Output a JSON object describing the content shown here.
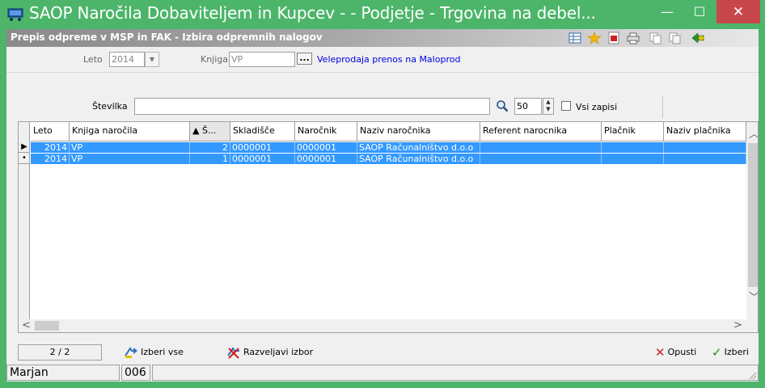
{
  "window": {
    "title": "SAOP Naročila Dobaviteljem in Kupcev -  - Podjetje - Trgovina na debel...",
    "minimize_glyph": "—",
    "maximize_glyph": "☐",
    "close_glyph": "✕"
  },
  "subtitle": "Prepis odpreme v MSP in FAK - Izbira odpremnih nalogov",
  "toolbar_icons": [
    "grid-view-icon",
    "star-icon",
    "pdf-icon",
    "print-icon",
    "copy-icon",
    "copy-alt-icon",
    "exit-icon"
  ],
  "filters": {
    "leto_label": "Leto",
    "leto_value": "2014",
    "knjiga_label": "Knjiga",
    "knjiga_value": "VP",
    "knjiga_button": "...",
    "knjiga_description": "Veleprodaja prenos na Maloprod",
    "stevilka_label": "Številka",
    "stevilka_value": "",
    "count_value": "50",
    "vsi_zapisi_label": "Vsi zapisi"
  },
  "table": {
    "columns": [
      "Leto",
      "Knjiga naročila",
      "▲ Š...",
      "Skladišče",
      "Naročnik",
      "Naziv naročnika",
      "Referent narocnika",
      "Plačnik",
      "Naziv plačnika"
    ],
    "rows": [
      {
        "indicator": "▶",
        "cells": [
          "2014",
          "VP",
          "2",
          "0000001",
          "0000001",
          "SAOP Računalništvo d.o.o",
          "",
          "",
          ""
        ]
      },
      {
        "indicator": "•",
        "cells": [
          "2014",
          "VP",
          "1",
          "0000001",
          "0000001",
          "SAOP Računalništvo d.o.o",
          "",
          "",
          ""
        ]
      }
    ]
  },
  "bottom": {
    "counter": "2 / 2",
    "select_all": "Izberi vse",
    "undo_selection": "Razveljavi izbor",
    "cancel": "Opusti",
    "choose": "Izberi"
  },
  "status": {
    "user": "Marjan",
    "code": "006"
  },
  "colors": {
    "frame": "#4cb56a",
    "selection": "#3399ff",
    "close": "#c7474b"
  }
}
